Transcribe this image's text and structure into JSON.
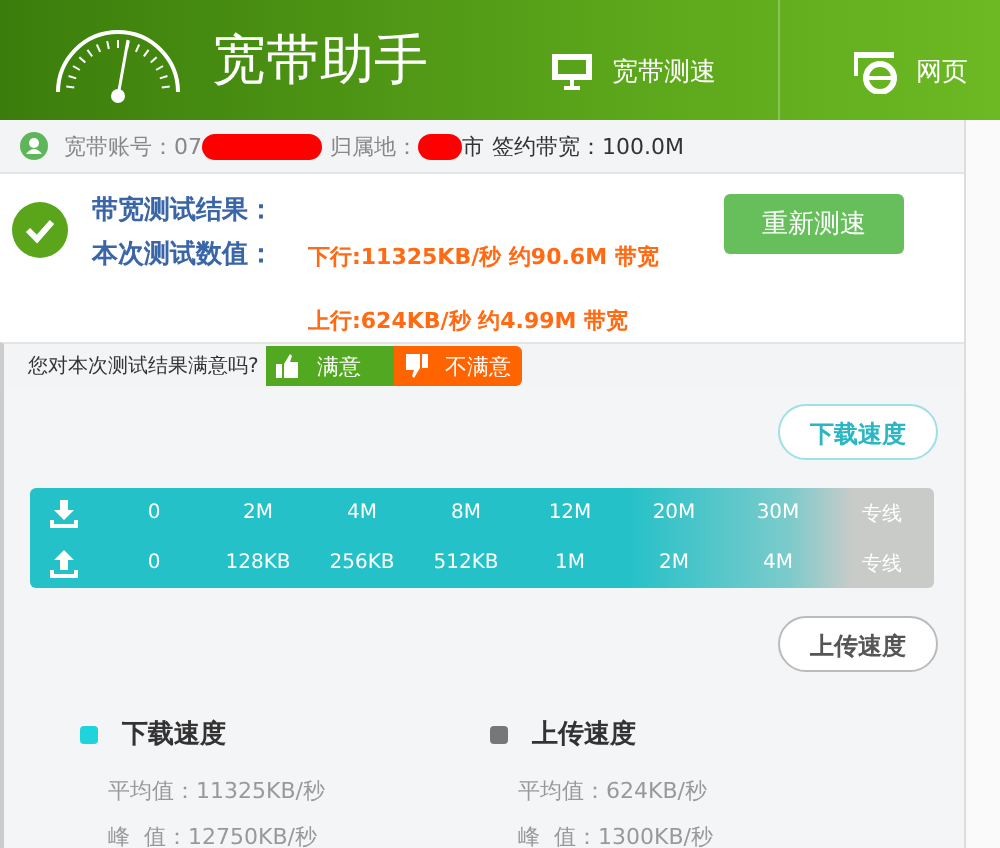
{
  "app": {
    "title": "宽带助手"
  },
  "nav": [
    {
      "label": "宽带测速",
      "kind": "monitor"
    },
    {
      "label": "网页",
      "kind": "browser"
    }
  ],
  "account": {
    "account_label": "宽带账号：07",
    "region_label": "归属地：",
    "region_suffix": "市",
    "plan": "签约带宽：100.0M"
  },
  "result": {
    "title": "带宽测试结果：",
    "values_label": "本次测试数值：",
    "download": "下行:11325KB/秒 约90.6M 带宽",
    "upload": "上行:624KB/秒 约4.99M 带宽",
    "retest_button": "重新测速"
  },
  "feedback": {
    "question": "您对本次测试结果满意吗?",
    "buttons": [
      {
        "label": "满意",
        "kind": "up"
      },
      {
        "label": "不满意",
        "kind": "down"
      }
    ]
  },
  "gauge": {
    "download_bubble": "下载速度",
    "upload_bubble": "上传速度",
    "download_ticks": [
      "0",
      "2M",
      "4M",
      "8M",
      "12M",
      "20M",
      "30M",
      "专线"
    ],
    "upload_ticks": [
      "0",
      "128KB",
      "256KB",
      "512KB",
      "1M",
      "2M",
      "4M",
      "专线"
    ]
  },
  "stats": [
    {
      "title": "下载速度",
      "color": "#1ed3dc",
      "average": "平均值：11325KB/秒",
      "peak": "峰  值：12750KB/秒"
    },
    {
      "title": "上传速度",
      "color": "#777777",
      "average": "平均值：624KB/秒",
      "peak": "峰  值：1300KB/秒"
    }
  ]
}
